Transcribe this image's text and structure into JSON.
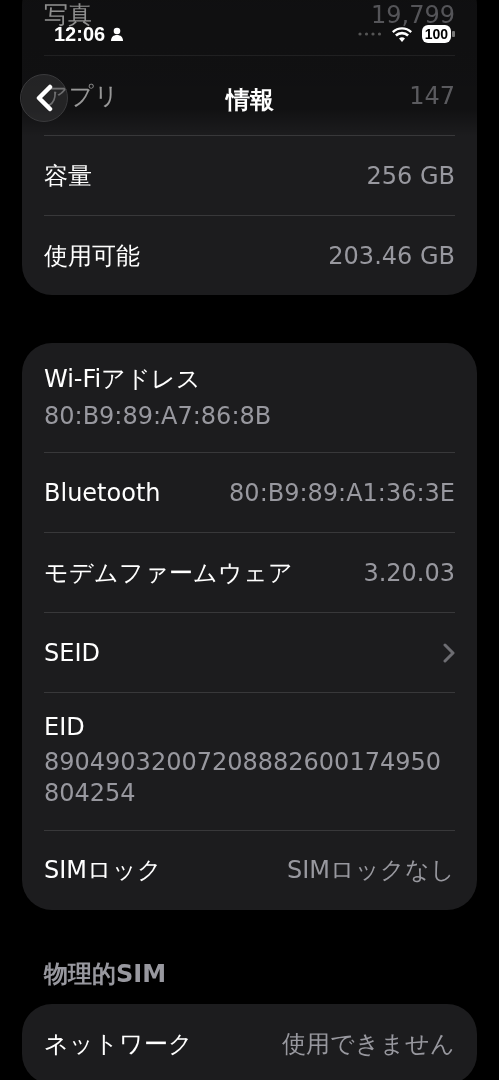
{
  "status_bar": {
    "time": "12:06",
    "battery": "100"
  },
  "nav": {
    "title": "情報"
  },
  "sections": [
    {
      "rows": [
        {
          "kind": "pair",
          "label": "写真",
          "value": "19,799"
        },
        {
          "kind": "pair",
          "label": "アプリ",
          "value": "147"
        },
        {
          "kind": "pair",
          "label": "容量",
          "value": "256 GB"
        },
        {
          "kind": "pair",
          "label": "使用可能",
          "value": "203.46 GB"
        }
      ]
    },
    {
      "rows": [
        {
          "kind": "stacked",
          "label": "Wi-Fiアドレス",
          "value": "80:B9:89:A7:86:8B"
        },
        {
          "kind": "pair",
          "label": "Bluetooth",
          "value": "80:B9:89:A1:36:3E"
        },
        {
          "kind": "pair",
          "label": "モデムファームウェア",
          "value": "3.20.03"
        },
        {
          "kind": "link",
          "label": "SEID"
        },
        {
          "kind": "stacked",
          "label": "EID",
          "value": "89049032007208882600174950804254"
        },
        {
          "kind": "pair",
          "label": "SIMロック",
          "value": "SIMロックなし"
        }
      ]
    },
    {
      "header": "物理的SIM",
      "rows": [
        {
          "kind": "pair",
          "label": "ネットワーク",
          "value": "使用できません"
        }
      ]
    }
  ]
}
